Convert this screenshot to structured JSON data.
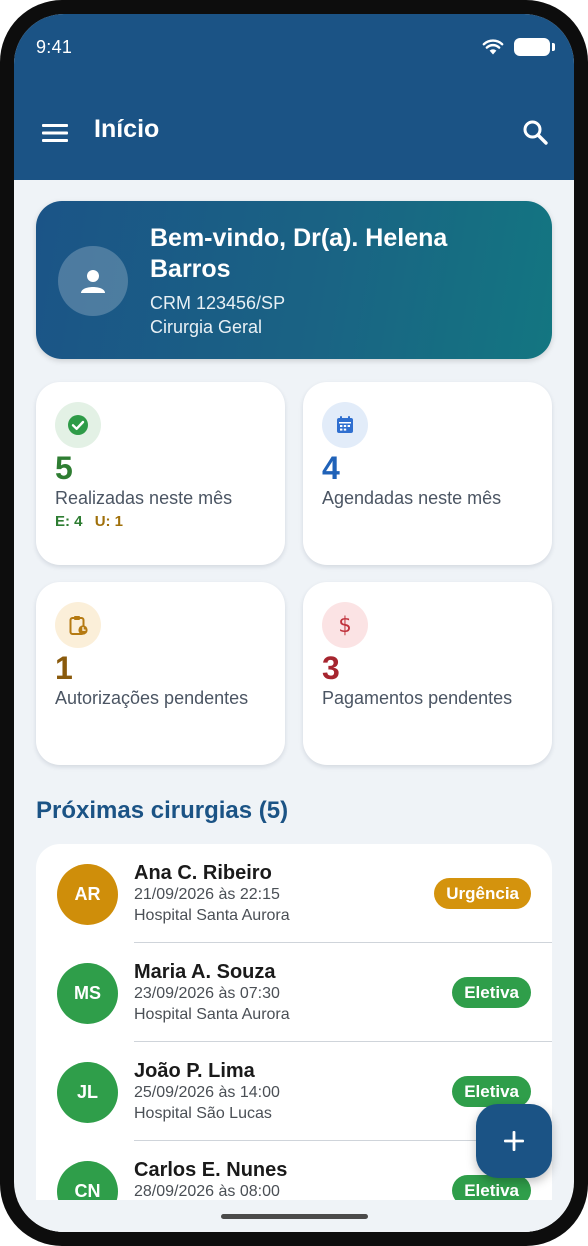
{
  "status_bar": {
    "time": "9:41"
  },
  "app_bar": {
    "title": "Início",
    "menu_icon": "menu-icon",
    "search_icon": "search-icon"
  },
  "welcome": {
    "title": "Bem-vindo, Dr(a). Helena Barros",
    "crm": "CRM 123456/SP",
    "specialty": "Cirurgia Geral",
    "avatar_icon": "person-icon"
  },
  "stats": [
    {
      "value": "5",
      "label": "Realizadas neste mês",
      "extra_e": "E: 4",
      "extra_u": "U: 1",
      "icon": "check-circle-icon",
      "color": "#2e7d32",
      "badge_bg": "#e3f1e5"
    },
    {
      "value": "4",
      "label": "Agendadas neste mês",
      "icon": "calendar-icon",
      "color": "#1f62b8",
      "badge_bg": "#e2ecf9"
    },
    {
      "value": "1",
      "label": "Autorizações pendentes",
      "icon": "clipboard-clock-icon",
      "color": "#8a5a0c",
      "badge_bg": "#fbefd9"
    },
    {
      "value": "3",
      "label": "Pagamentos pendentes",
      "icon": "dollar-icon",
      "color": "#a6252f",
      "badge_bg": "#fbe3e4"
    }
  ],
  "upcoming": {
    "title": "Próximas cirurgias (5)",
    "items": [
      {
        "initials": "AR",
        "name": "Ana C. Ribeiro",
        "datetime": "21/09/2026 às 22:15",
        "hospital": "Hospital Santa Aurora",
        "tag": "Urgência",
        "avatar_color": "#cf8e0a",
        "tag_color": "#d4930d"
      },
      {
        "initials": "MS",
        "name": "Maria A. Souza",
        "datetime": "23/09/2026 às 07:30",
        "hospital": "Hospital Santa Aurora",
        "tag": "Eletiva",
        "avatar_color": "#2f9e4a",
        "tag_color": "#2f9e4a"
      },
      {
        "initials": "JL",
        "name": "João P. Lima",
        "datetime": "25/09/2026 às 14:00",
        "hospital": "Hospital São Lucas",
        "tag": "Eletiva",
        "avatar_color": "#2f9e4a",
        "tag_color": "#2f9e4a"
      },
      {
        "initials": "CN",
        "name": "Carlos E. Nunes",
        "datetime": "28/09/2026 às 08:00",
        "hospital": "",
        "tag": "Eletiva",
        "avatar_color": "#2f9e4a",
        "tag_color": "#2f9e4a"
      }
    ]
  },
  "fab": {
    "icon": "plus-icon"
  },
  "colors": {
    "primary": "#1b5385",
    "background": "#eff3f7",
    "urgent": "#d4930d",
    "elective": "#2f9e4a"
  }
}
